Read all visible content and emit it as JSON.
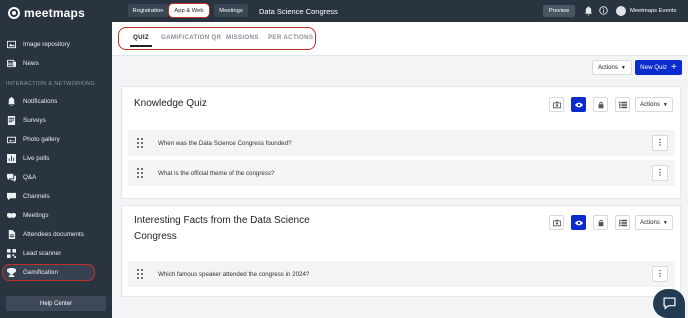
{
  "app": {
    "logo_text": "meetmaps"
  },
  "sidebar": {
    "items_top": [
      {
        "label": "Image repository",
        "icon": "image-icon"
      },
      {
        "label": "News",
        "icon": "news-icon"
      }
    ],
    "section_label": "INTERACTION & NETWORKING",
    "items": [
      {
        "label": "Notifications",
        "icon": "bell-icon"
      },
      {
        "label": "Surveys",
        "icon": "survey-icon"
      },
      {
        "label": "Photo gallery",
        "icon": "photo-icon"
      },
      {
        "label": "Live polls",
        "icon": "poll-icon"
      },
      {
        "label": "Q&A",
        "icon": "qa-icon"
      },
      {
        "label": "Channels",
        "icon": "channels-icon"
      },
      {
        "label": "Meetings",
        "icon": "handshake-icon"
      },
      {
        "label": "Attendees documents",
        "icon": "document-icon"
      },
      {
        "label": "Lead scanner",
        "icon": "scanner-icon"
      },
      {
        "label": "Gamification",
        "icon": "trophy-icon",
        "active": true
      }
    ],
    "help_label": "Help Center"
  },
  "topbar": {
    "tabs": [
      {
        "label": "Registration"
      },
      {
        "label": "App & Web",
        "active": true
      },
      {
        "label": "Meetings"
      }
    ],
    "event_title": "Data Science Congress",
    "preview_label": "Preview",
    "user_name": "Meetmaps Events"
  },
  "subtabs": [
    {
      "label": "QUIZ",
      "active": true
    },
    {
      "label": "GAMIFICATION QR"
    },
    {
      "label": "MISSIONS"
    },
    {
      "label": "PER ACTIONS"
    }
  ],
  "toolbar": {
    "actions_label": "Actions",
    "new_quiz_label": "New Quiz"
  },
  "cards": [
    {
      "title": "Knowledge Quiz",
      "actions_label": "Actions",
      "questions": [
        "When was the Data Science Congress founded?",
        "What is the official theme of the congress?"
      ]
    },
    {
      "title_line1": "Interesting Facts from the Data Science",
      "title_line2": "Congress",
      "actions_label": "Actions",
      "questions": [
        "Which famous speaker attended the congress in 2024?"
      ]
    }
  ],
  "colors": {
    "sidebar_bg": "#2a3441",
    "accent_blue": "#0c2bcf",
    "highlight_red": "#c0302a"
  }
}
